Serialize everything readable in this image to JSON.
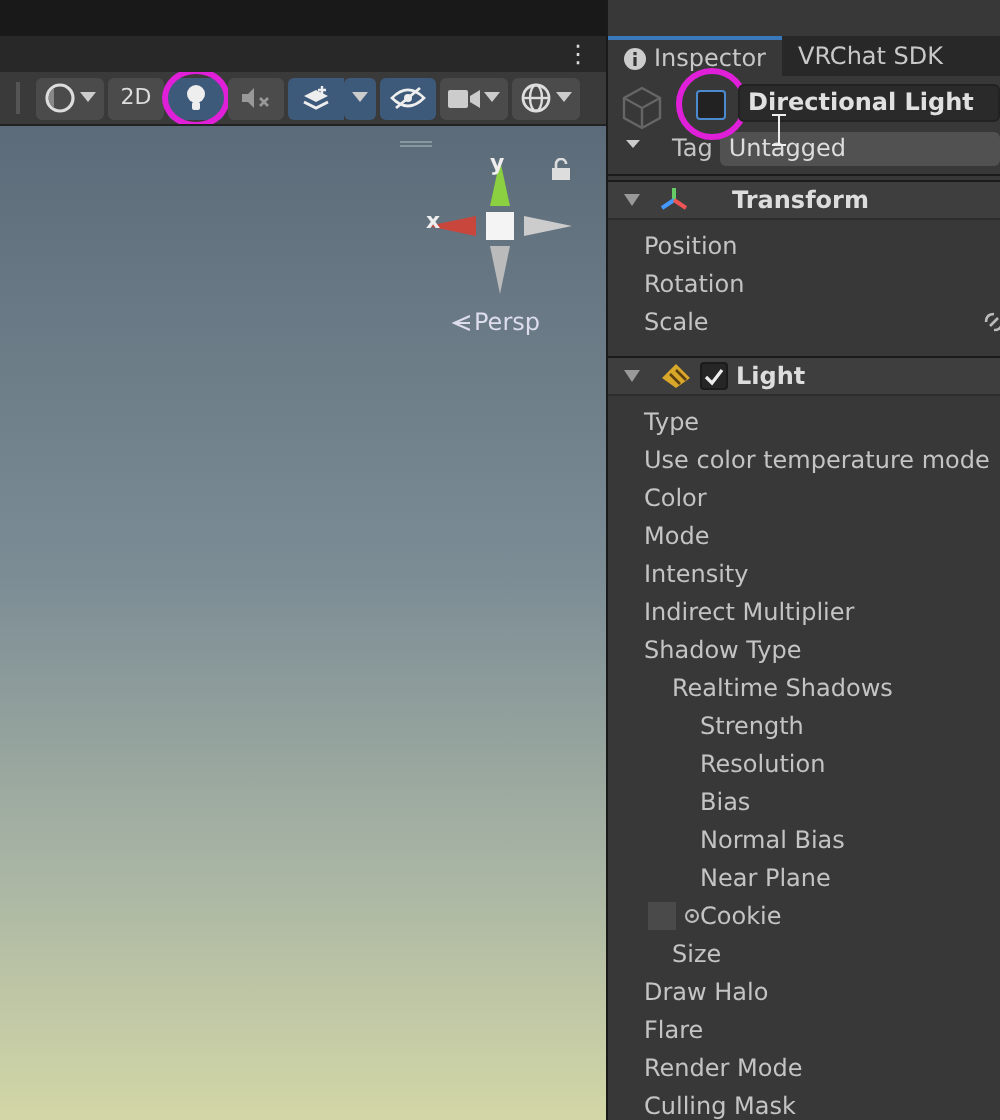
{
  "top_bar": {
    "menu_glyph": "⋮"
  },
  "scene_toolbar": {
    "buttons": [
      {
        "kind": "shading",
        "selected": false,
        "circled": false
      },
      {
        "kind": "text",
        "label": "2D",
        "selected": false,
        "circled": false
      },
      {
        "kind": "lighting",
        "selected": true,
        "circled": true
      },
      {
        "kind": "audio",
        "selected": false,
        "circled": false
      },
      {
        "kind": "effects",
        "selected": true,
        "circled": false
      },
      {
        "kind": "visibility",
        "selected": true,
        "circled": false
      },
      {
        "kind": "camera",
        "selected": false,
        "circled": false
      },
      {
        "kind": "gizmos",
        "selected": false,
        "circled": false
      }
    ]
  },
  "scene_view": {
    "axis_x": "x",
    "axis_y": "y",
    "projection": "Persp"
  },
  "inspector": {
    "tabs": [
      {
        "label": "Inspector",
        "selected": true
      },
      {
        "label": "VRChat SDK",
        "selected": false
      }
    ],
    "object": {
      "active": false,
      "circled": true,
      "name": "Directional Light",
      "tag_label": "Tag",
      "tag": "Untagged"
    },
    "components": [
      {
        "kind": "transform",
        "title": "Transform",
        "properties": [
          {
            "label": "Position",
            "kind": "field"
          },
          {
            "label": "Rotation",
            "kind": "field"
          },
          {
            "label": "Scale",
            "kind": "scale"
          }
        ]
      },
      {
        "kind": "light",
        "title": "Light",
        "enabled": true,
        "properties": [
          {
            "label": "Type",
            "kind": "field"
          },
          {
            "label": "Use color temperature mode",
            "kind": "field"
          },
          {
            "label": "Color",
            "kind": "field"
          },
          {
            "label": "Mode",
            "kind": "field"
          },
          {
            "label": "Intensity",
            "kind": "field"
          },
          {
            "label": "Indirect Multiplier",
            "kind": "field"
          },
          {
            "label": "Shadow Type",
            "kind": "field",
            "children": [
              {
                "label": "Realtime Shadows",
                "kind": "field",
                "children": [
                  {
                    "label": "Strength",
                    "kind": "field"
                  },
                  {
                    "label": "Resolution",
                    "kind": "field"
                  },
                  {
                    "label": "Bias",
                    "kind": "field"
                  },
                  {
                    "label": "Normal Bias",
                    "kind": "field"
                  },
                  {
                    "label": "Near Plane",
                    "kind": "field"
                  },
                  {
                    "label": "Cookie",
                    "kind": "cookie"
                  }
                ]
              },
              {
                "label": "Size",
                "kind": "field"
              }
            ]
          },
          {
            "label": "Draw Halo",
            "kind": "field"
          },
          {
            "label": "Flare",
            "kind": "field"
          },
          {
            "label": "Render Mode",
            "kind": "field"
          },
          {
            "label": "Culling Mask",
            "kind": "field"
          }
        ]
      }
    ]
  }
}
